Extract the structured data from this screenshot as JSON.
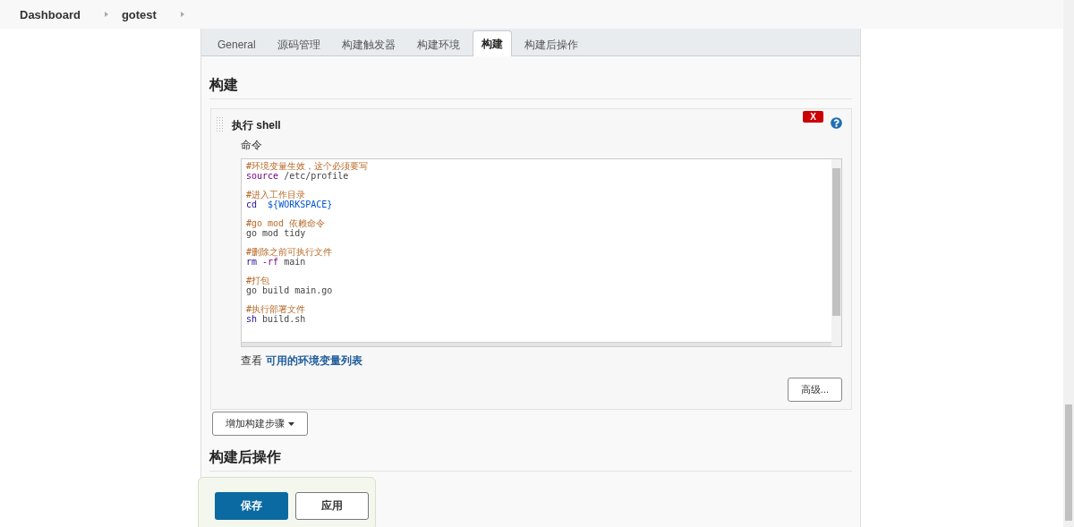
{
  "breadcrumbs": [
    {
      "label": "Dashboard"
    },
    {
      "label": "gotest"
    }
  ],
  "tabs": [
    {
      "label": "General",
      "selected": false
    },
    {
      "label": "源码管理",
      "selected": false
    },
    {
      "label": "构建触发器",
      "selected": false
    },
    {
      "label": "构建环境",
      "selected": false
    },
    {
      "label": "构建",
      "selected": true
    },
    {
      "label": "构建后操作",
      "selected": false
    }
  ],
  "section_title": "构建",
  "build_step": {
    "title": "执行 shell",
    "delete_label": "X",
    "command_label": "命令",
    "script_groups": [
      {
        "comment": "#环境变量生效，这个必须要写",
        "code": [
          {
            "kind": "keyword",
            "text": "source"
          },
          {
            "kind": "plain",
            "text": " /etc/profile"
          }
        ]
      },
      {
        "comment": "#进入工作目录",
        "code": [
          {
            "kind": "builtin",
            "text": "cd"
          },
          {
            "kind": "variable",
            "text": "  ${WORKSPACE}"
          }
        ]
      },
      {
        "comment": "#go mod 依赖命令",
        "code": [
          {
            "kind": "plain",
            "text": "go mod tidy"
          }
        ]
      },
      {
        "comment": "#删除之前可执行文件",
        "code": [
          {
            "kind": "builtin",
            "text": "rm"
          },
          {
            "kind": "keyword",
            "text": " -rf"
          },
          {
            "kind": "plain",
            "text": " main"
          }
        ]
      },
      {
        "comment": "#打包",
        "code": [
          {
            "kind": "plain",
            "text": "go build main.go"
          }
        ]
      },
      {
        "comment": "#执行部署文件",
        "code": [
          {
            "kind": "builtin",
            "text": "sh"
          },
          {
            "kind": "plain",
            "text": " build.sh"
          }
        ]
      }
    ],
    "env_hint": {
      "prefix": "查看",
      "link": "可用的环境变量列表"
    },
    "advanced_button": "高级..."
  },
  "add_step_button": "增加构建步骤",
  "post_section_title": "构建后操作",
  "save_button": "保存",
  "apply_button": "应用"
}
